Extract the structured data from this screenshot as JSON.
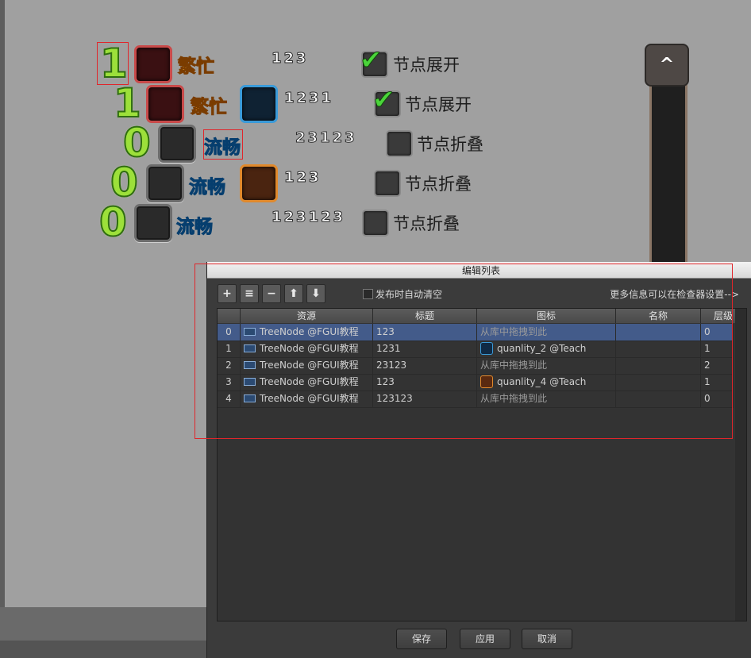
{
  "tree": {
    "rows": [
      {
        "level": "1",
        "status": "繁忙",
        "status_kind": "busy",
        "value": "123",
        "node_state": "节点展开",
        "checked": true,
        "icon": "empty-slot"
      },
      {
        "level": "1",
        "status": "繁忙",
        "status_kind": "busy",
        "value": "1231",
        "node_state": "节点展开",
        "checked": true,
        "icon": "quanlity-2-thumbnail"
      },
      {
        "level": "0",
        "status": "流畅",
        "status_kind": "smooth",
        "value": "23123",
        "node_state": "节点折叠",
        "checked": false,
        "icon": "empty-slot"
      },
      {
        "level": "0",
        "status": "流畅",
        "status_kind": "smooth",
        "value": "123",
        "node_state": "节点折叠",
        "checked": false,
        "icon": "quanlity-4-thumbnail"
      },
      {
        "level": "0",
        "status": "流畅",
        "status_kind": "smooth",
        "value": "123123",
        "node_state": "节点折叠",
        "checked": false,
        "icon": "empty-slot"
      }
    ],
    "scroll_up_glyph": "^",
    "colors": {
      "busy": "#ffb02e",
      "smooth": "#35c8ff",
      "level": "#9ce03a"
    }
  },
  "dialog": {
    "title": "编辑列表",
    "toolbar": {
      "add": "+",
      "insert": "≡",
      "remove": "−",
      "move_up": "⬆",
      "move_down": "⬇"
    },
    "auto_clear_label": "发布时自动清空",
    "more_info": "更多信息可以在检查器设置-->",
    "columns": {
      "resource": "资源",
      "title": "标题",
      "icon": "图标",
      "name": "名称",
      "level": "层级"
    },
    "rows": [
      {
        "index": "0",
        "resource": "TreeNode @FGUI教程",
        "title": "123",
        "icon": "从库中拖拽到此",
        "name": "",
        "level": "0",
        "selected": true
      },
      {
        "index": "1",
        "resource": "TreeNode @FGUI教程",
        "title": "1231",
        "icon": "quanlity_2 @Teach",
        "name": "",
        "level": "1",
        "selected": false
      },
      {
        "index": "2",
        "resource": "TreeNode @FGUI教程",
        "title": "23123",
        "icon": "从库中拖拽到此",
        "name": "",
        "level": "2",
        "selected": false
      },
      {
        "index": "3",
        "resource": "TreeNode @FGUI教程",
        "title": "123",
        "icon": "quanlity_4 @Teach",
        "name": "",
        "level": "1",
        "selected": false
      },
      {
        "index": "4",
        "resource": "TreeNode @FGUI教程",
        "title": "123123",
        "icon": "从库中拖拽到此",
        "name": "",
        "level": "0",
        "selected": false
      }
    ],
    "buttons": {
      "save": "保存",
      "apply": "应用",
      "cancel": "取消"
    },
    "accent": "#435b8a"
  }
}
